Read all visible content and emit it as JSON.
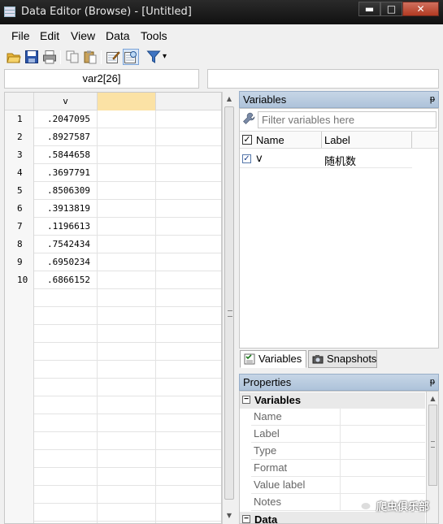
{
  "window": {
    "title": "Data Editor (Browse) - [Untitled]",
    "min_label": "▬",
    "max_label": "□",
    "close_label": "✕"
  },
  "menu": [
    "File",
    "Edit",
    "View",
    "Data",
    "Tools"
  ],
  "toolbar": {
    "icons": [
      "open-icon",
      "save-icon",
      "print-icon",
      "copy-icon",
      "paste-icon",
      "edit-mode-icon",
      "browse-mode-icon",
      "filter-icon"
    ],
    "filter_dropdown": "▾"
  },
  "cell_bar": {
    "variable_cell": "var2[26]",
    "value": ""
  },
  "grid": {
    "columns": [
      "v",
      "",
      ""
    ],
    "rows": [
      {
        "n": "1",
        "v": ".2047095"
      },
      {
        "n": "2",
        "v": ".8927587"
      },
      {
        "n": "3",
        "v": ".5844658"
      },
      {
        "n": "4",
        "v": ".3697791"
      },
      {
        "n": "5",
        "v": ".8506309"
      },
      {
        "n": "6",
        "v": ".3913819"
      },
      {
        "n": "7",
        "v": ".1196613"
      },
      {
        "n": "8",
        "v": ".7542434"
      },
      {
        "n": "9",
        "v": ".6950234"
      },
      {
        "n": "10",
        "v": ".6866152"
      },
      {
        "n": "",
        "v": ""
      },
      {
        "n": "",
        "v": ""
      },
      {
        "n": "",
        "v": ""
      },
      {
        "n": "",
        "v": ""
      },
      {
        "n": "",
        "v": ""
      },
      {
        "n": "",
        "v": ""
      },
      {
        "n": "",
        "v": ""
      },
      {
        "n": "",
        "v": ""
      },
      {
        "n": "",
        "v": ""
      },
      {
        "n": "",
        "v": ""
      },
      {
        "n": "",
        "v": ""
      },
      {
        "n": "",
        "v": ""
      },
      {
        "n": "",
        "v": ""
      },
      {
        "n": "",
        "v": ""
      }
    ]
  },
  "variables_pane": {
    "title": "Variables",
    "pin": "ᵽ",
    "filter_placeholder": "Filter variables here",
    "col_name": "Name",
    "col_label": "Label",
    "header_check": "✓",
    "items": [
      {
        "checked": "✓",
        "name": "v",
        "label": "随机数"
      }
    ]
  },
  "tabs": [
    "Variables",
    "Snapshots"
  ],
  "properties_pane": {
    "title": "Properties",
    "pin": "ᵽ",
    "groups": [
      {
        "name": "Variables",
        "toggle": "−",
        "rows": [
          "Name",
          "Label",
          "Type",
          "Format",
          "Value label",
          "Notes"
        ]
      },
      {
        "name": "Data",
        "toggle": "−",
        "rows": []
      }
    ]
  },
  "watermark": "爬虫俱乐部"
}
